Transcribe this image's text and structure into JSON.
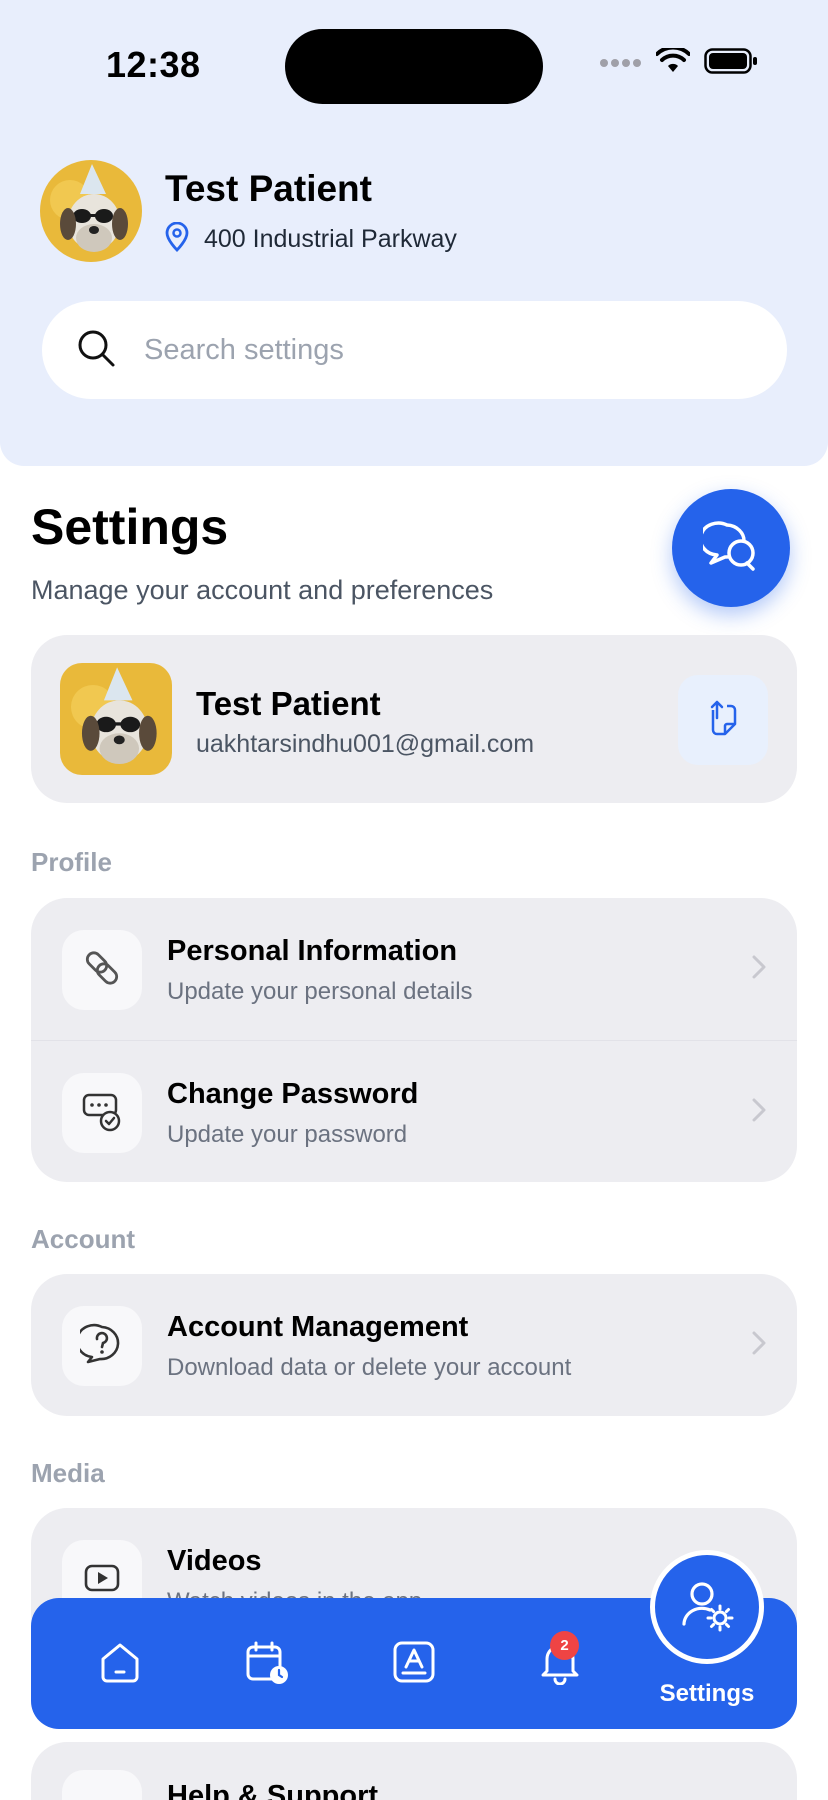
{
  "status_bar": {
    "time": "12:38"
  },
  "header": {
    "patient_name": "Test Patient",
    "location": "400 Industrial Parkway",
    "avatar_icon": "dog-with-party-hat-avatar"
  },
  "search": {
    "placeholder": "Search settings",
    "value": ""
  },
  "page": {
    "title": "Settings",
    "subtitle": "Manage your account and preferences"
  },
  "profile_card": {
    "name": "Test Patient",
    "email": "uakhtarsindhu001@gmail.com",
    "action_icon": "switch-account-icon"
  },
  "sections": {
    "profile": {
      "label": "Profile",
      "items": [
        {
          "title": "Personal Information",
          "subtitle": "Update your personal details",
          "icon": "link-icon"
        },
        {
          "title": "Change Password",
          "subtitle": "Update your password",
          "icon": "password-check-icon"
        }
      ]
    },
    "account": {
      "label": "Account",
      "items": [
        {
          "title": "Account Management",
          "subtitle": "Download data or delete your account",
          "icon": "question-bubble-icon"
        }
      ]
    },
    "media": {
      "label": "Media",
      "items": [
        {
          "title": "Videos",
          "subtitle": "Watch videos in the app",
          "icon": "video-play-icon"
        }
      ]
    },
    "help": {
      "title": "Help & Support"
    }
  },
  "tabbar": {
    "tabs": [
      {
        "name": "home",
        "icon": "home-icon"
      },
      {
        "name": "appointments",
        "icon": "calendar-clock-icon"
      },
      {
        "name": "apps",
        "icon": "app-store-icon"
      },
      {
        "name": "notifications",
        "icon": "bell-icon",
        "badge": "2"
      },
      {
        "name": "settings",
        "icon": "user-gear-icon",
        "label": "Settings",
        "active": true
      }
    ]
  },
  "colors": {
    "primary": "#2563eb",
    "header_bg": "#e8eefc",
    "card_bg": "#ededf1",
    "badge": "#ef4444"
  }
}
